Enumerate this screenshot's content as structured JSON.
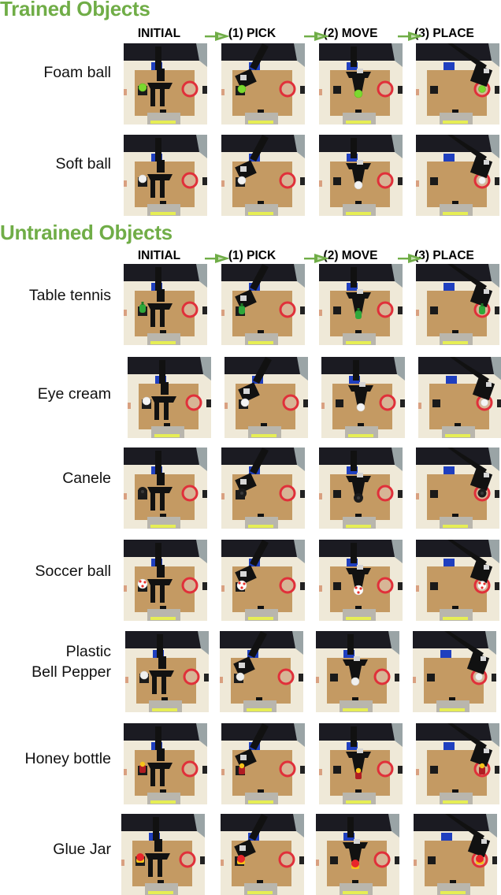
{
  "sections": [
    {
      "title": "Trained Objects",
      "stages": [
        "INITIAL",
        "(1) PICK",
        "(2) MOVE",
        "(3) PLACE"
      ],
      "rows": [
        {
          "label": "Foam ball",
          "object": {
            "color": "#7bd92f",
            "accent": "#5fb81c",
            "shape": "ball"
          }
        },
        {
          "label": "Soft ball",
          "object": {
            "color": "#f2f2f2",
            "accent": "#cfcfcf",
            "shape": "ball"
          }
        }
      ]
    },
    {
      "title": "Untrained Objects",
      "stages": [
        "INITIAL",
        "(1) PICK",
        "(2) MOVE",
        "(3) PLACE"
      ],
      "rows": [
        {
          "label": "Table tennis",
          "object": {
            "color": "#2ea83a",
            "accent": "#1f7a28",
            "shape": "paddle"
          }
        },
        {
          "label": "Eye cream",
          "object": {
            "color": "#f4f4f4",
            "accent": "#d0d0d0",
            "shape": "ball"
          }
        },
        {
          "label": "Canele",
          "object": {
            "color": "#1c1c1c",
            "accent": "#3a3a3a",
            "shape": "canele"
          }
        },
        {
          "label": "Soccer ball",
          "object": {
            "color": "#ffffff",
            "accent": "#e8302a",
            "shape": "soccer"
          }
        },
        {
          "label": "Plastic\nBell Pepper",
          "object": {
            "color": "#f0f0ee",
            "accent": "#cfcfcf",
            "shape": "ball"
          }
        },
        {
          "label": "Honey bottle",
          "object": {
            "color": "#b01c22",
            "accent": "#f5c21b",
            "shape": "bottle"
          }
        },
        {
          "label": "Glue Jar",
          "object": {
            "color": "#e8262a",
            "accent": "#f5c21b",
            "shape": "jar"
          }
        }
      ]
    }
  ],
  "colors": {
    "section_title": "#70ad47",
    "arrow": "#70ad47",
    "arrow_inner": "#c6e0b4",
    "table": "#c49a63",
    "floor": "#efe9d8",
    "wall": "#1b1b22",
    "bowl": "#e0303a",
    "robot": "#111111",
    "base": "#1f3fbf"
  }
}
